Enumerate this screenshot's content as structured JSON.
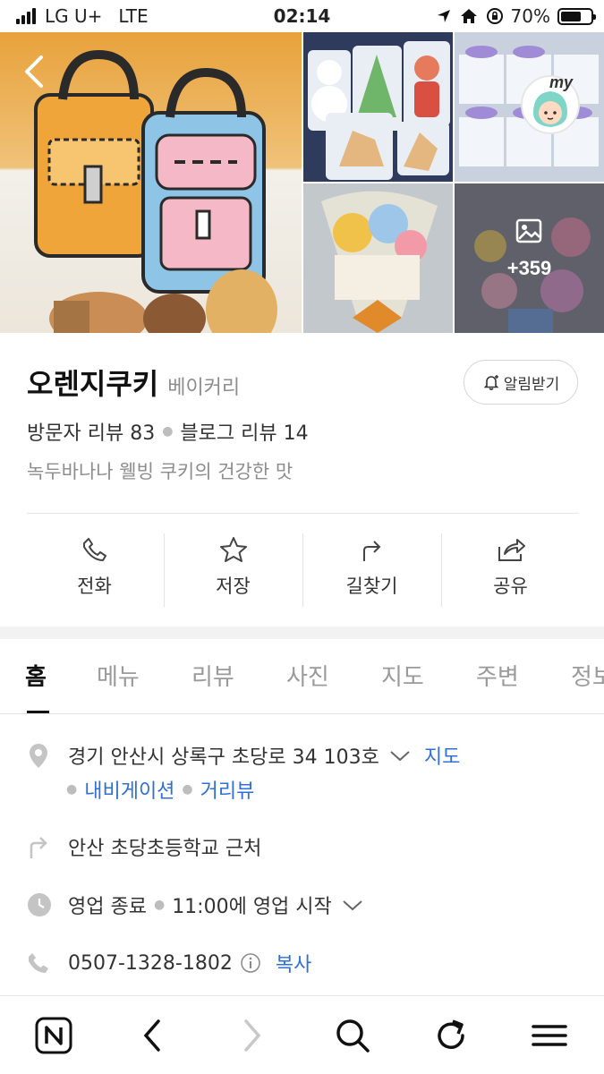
{
  "status_bar": {
    "carrier": "LG U+",
    "network": "LTE",
    "time": "02:14",
    "battery": "70%",
    "battery_level": 0.7
  },
  "photos": {
    "more_count": "+359",
    "badge_text": "my"
  },
  "place": {
    "name": "오렌지쿠키",
    "category": "베이커리",
    "alarm_label": "알림받기",
    "visitor_review_label": "방문자 리뷰",
    "visitor_review_count": "83",
    "blog_review_label": "블로그 리뷰",
    "blog_review_count": "14",
    "description": "녹두바나나 웰빙 쿠키의 건강한 맛"
  },
  "actions": [
    {
      "label": "전화",
      "icon": "phone-icon"
    },
    {
      "label": "저장",
      "icon": "star-icon"
    },
    {
      "label": "길찾기",
      "icon": "directions-icon"
    },
    {
      "label": "공유",
      "icon": "share-icon"
    }
  ],
  "tabs": [
    "홈",
    "메뉴",
    "리뷰",
    "사진",
    "지도",
    "주변",
    "정보"
  ],
  "active_tab": "홈",
  "info": {
    "address": "경기 안산시 상록구 초당로 34 103호",
    "map_link": "지도",
    "navigation_link": "내비게이션",
    "streetview_link": "거리뷰",
    "directions_hint": "안산 초당초등학교 근처",
    "hours_status": "영업 종료",
    "hours_detail": "11:00에 영업 시작",
    "phone": "0507-1328-1802",
    "copy_label": "복사"
  },
  "colors": {
    "link": "#2f6fd6",
    "muted": "#8d8d8d",
    "icon_gray": "#c4c4c4"
  }
}
